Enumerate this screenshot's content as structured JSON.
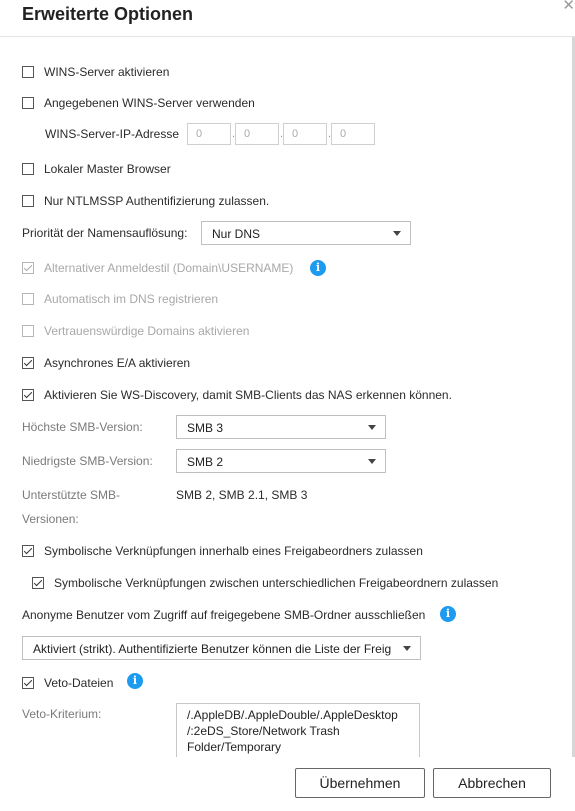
{
  "dialog": {
    "title": "Erweiterte Optionen"
  },
  "options": {
    "wins_enable": "WINS-Server aktivieren",
    "wins_specified": "Angegebenen WINS-Server verwenden",
    "wins_ip_label": "WINS-Server-IP-Adresse",
    "wins_ip": [
      "0",
      "0",
      "0",
      "0"
    ],
    "local_master": "Lokaler Master Browser",
    "ntlmssp": "Nur NTLMSSP Authentifizierung zulassen.",
    "name_resolution_label": "Priorität der Namensauflösung:",
    "name_resolution_value": "Nur DNS",
    "alt_login": "Alternativer Anmeldestil (Domain\\USERNAME)",
    "dns_register": "Automatisch im DNS registrieren",
    "trusted_domains": "Vertrauenswürdige Domains aktivieren",
    "async_io": "Asynchrones E/A aktivieren",
    "ws_discovery": "Aktivieren Sie WS-Discovery, damit SMB-Clients das NAS erkennen können.",
    "smb_max_label": "Höchste SMB-Version:",
    "smb_max_value": "SMB 3",
    "smb_min_label": "Niedrigste SMB-Version:",
    "smb_min_value": "SMB 2",
    "smb_supported_label_1": "Unterstützte SMB-",
    "smb_supported_label_2": "Versionen:",
    "smb_supported_value": "SMB 2, SMB 2.1, SMB 3",
    "symlink_within": "Symbolische Verknüpfungen innerhalb eines Freigabeordners zulassen",
    "symlink_between": "Symbolische Verknüpfungen zwischen unterschiedlichen Freigabeordnern zulassen",
    "anon_label": "Anonyme Benutzer vom Zugriff auf freigegebene SMB-Ordner ausschließen",
    "anon_value": "Aktiviert (strikt). Authentifizierte Benutzer können die Liste der Freig",
    "veto_files": "Veto-Dateien",
    "veto_criteria_label": "Veto-Kriterium:",
    "veto_criteria_lines": [
      "/.AppleDB/.AppleDouble/.AppleDesktop",
      "/:2eDS_Store/Network Trash",
      "Folder/Temporary"
    ]
  },
  "info_icon_glyph": "i",
  "close_glyph": "✕",
  "buttons": {
    "apply": "Übernehmen",
    "cancel": "Abbrechen"
  },
  "colors": {
    "info": "#1d9bf0",
    "disabled_text": "#a8a8a8"
  }
}
